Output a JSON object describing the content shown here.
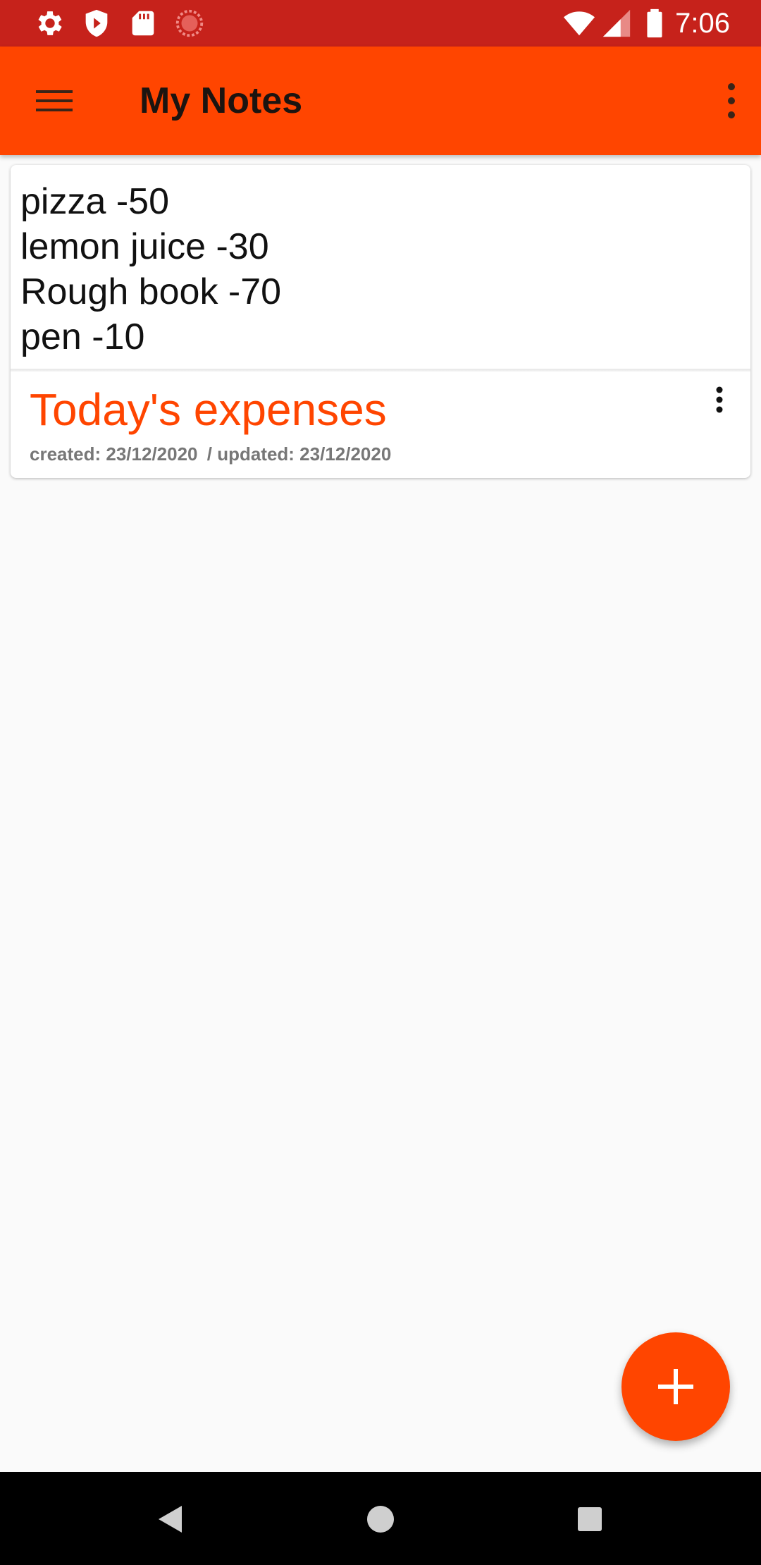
{
  "status_bar": {
    "time": "7:06",
    "icons": [
      "settings-icon",
      "shield-icon",
      "sd-card-icon",
      "loading-icon",
      "wifi-icon",
      "signal-icon",
      "battery-icon"
    ]
  },
  "app_bar": {
    "title": "My Notes",
    "menu_icon": "hamburger-menu-icon",
    "overflow_icon": "more-vert-icon"
  },
  "notes": [
    {
      "lines": [
        "pizza -50",
        "lemon juice -30",
        "Rough book -70",
        "pen -10"
      ],
      "title": "Today's expenses",
      "created": "created: 23/12/2020",
      "updated": "/ updated: 23/12/2020",
      "menu_icon": "more-vert-icon"
    }
  ],
  "fab": {
    "icon": "plus-icon"
  },
  "nav_bar": {
    "icons": [
      "back-icon",
      "home-icon",
      "recents-icon"
    ]
  },
  "colors": {
    "status_bar": "#c6221b",
    "accent": "#ff4500",
    "background": "#fafafa",
    "title_text": "#1c1410",
    "meta_text": "#777777"
  }
}
